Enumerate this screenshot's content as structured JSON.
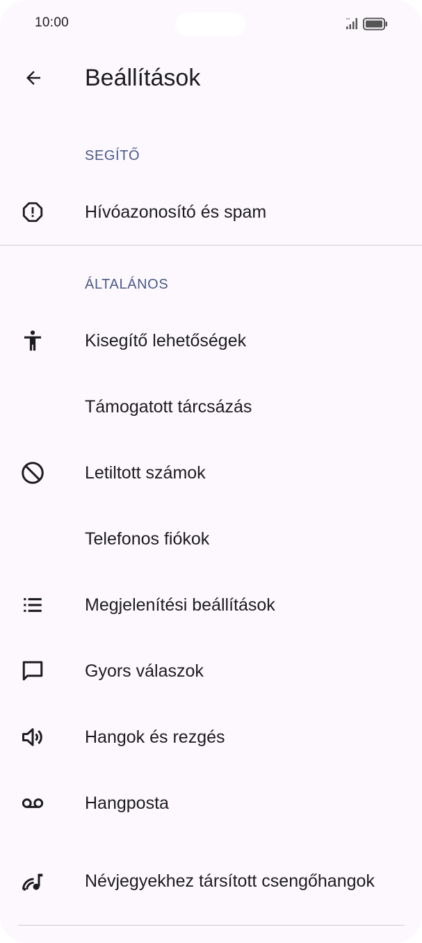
{
  "status_bar": {
    "time": "10:00",
    "signal_icon": "signal-icon",
    "battery_icon": "battery-icon"
  },
  "header": {
    "title": "Beállítások",
    "back_icon": "arrow-back-icon"
  },
  "sections": {
    "assistant": {
      "title": "SEGÍTŐ",
      "items": [
        {
          "label": "Hívóazonosító és spam",
          "icon": "alert-octagon-icon"
        }
      ]
    },
    "general": {
      "title": "ÁLTALÁNOS",
      "items": [
        {
          "label": "Kisegítő lehetőségek",
          "icon": "accessibility-icon"
        },
        {
          "label": "Támogatott tárcsázás",
          "icon": ""
        },
        {
          "label": "Letiltott számok",
          "icon": "block-icon"
        },
        {
          "label": "Telefonos fiókok",
          "icon": ""
        },
        {
          "label": "Megjelenítési beállítások",
          "icon": "list-icon"
        },
        {
          "label": "Gyors válaszok",
          "icon": "chat-bubble-icon"
        },
        {
          "label": "Hangok és rezgés",
          "icon": "volume-icon"
        },
        {
          "label": "Hangposta",
          "icon": "voicemail-icon"
        },
        {
          "label": "Névjegyekhez társított csengőhangok",
          "icon": "ringtone-icon"
        }
      ]
    }
  },
  "colors": {
    "background": "#fcf8fd",
    "section_header": "#4a5a8a",
    "text": "#1c1b1f",
    "divider": "#cfcbd3"
  }
}
